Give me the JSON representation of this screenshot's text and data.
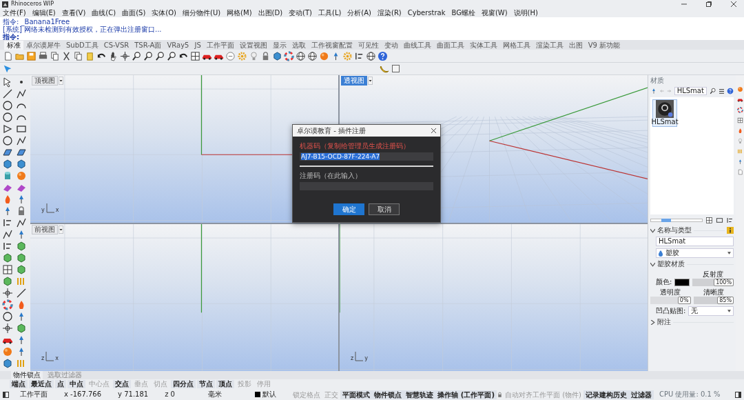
{
  "window": {
    "title": "Rhinoceros WIP"
  },
  "menu": [
    "文件(F)",
    "编辑(E)",
    "查看(V)",
    "曲线(C)",
    "曲面(S)",
    "实体(O)",
    "细分物件(U)",
    "网格(M)",
    "出图(D)",
    "变动(T)",
    "工具(L)",
    "分析(A)",
    "渲染(R)",
    "Cyberstrak",
    "BG螺栓",
    "视窗(W)",
    "说明(H)"
  ],
  "command_history": [
    "指令: _Banana1Free",
    "[系统] 网络未检测到有效授权，正在弹出注册窗口..."
  ],
  "command_prompt": "指令:",
  "toolbar_tabs": [
    {
      "label": "标准",
      "selected": true
    },
    {
      "label": "卓尔谟犀牛",
      "selected": false
    },
    {
      "label": "SubD工具",
      "selected": false
    },
    {
      "label": "CS-VSR",
      "selected": false
    },
    {
      "label": "TSR-A面",
      "selected": false
    },
    {
      "label": "VRay5",
      "selected": false
    },
    {
      "label": "JS",
      "selected": false
    },
    {
      "label": "工作平面",
      "selected": false
    },
    {
      "label": "设置视图",
      "selected": false
    },
    {
      "label": "显示",
      "selected": false
    },
    {
      "label": "选取",
      "selected": false
    },
    {
      "label": "工作视窗配置",
      "selected": false
    },
    {
      "label": "可见性",
      "selected": false
    },
    {
      "label": "变动",
      "selected": false
    },
    {
      "label": "曲线工具",
      "selected": false
    },
    {
      "label": "曲面工具",
      "selected": false
    },
    {
      "label": "实体工具",
      "selected": false
    },
    {
      "label": "网格工具",
      "selected": false
    },
    {
      "label": "渲染工具",
      "selected": false
    },
    {
      "label": "出图",
      "selected": false
    },
    {
      "label": "V9 新功能",
      "selected": false
    }
  ],
  "viewports": [
    {
      "kind": "top",
      "label": "顶视图",
      "selected": false,
      "axis_labels": [
        "y",
        "x"
      ]
    },
    {
      "kind": "perspective",
      "label": "透视图",
      "selected": true
    },
    {
      "kind": "front",
      "label": "前视图",
      "selected": false,
      "axis_labels": [
        "z",
        "x"
      ]
    },
    {
      "kind": "right",
      "axis_labels": [
        "z",
        "y"
      ]
    }
  ],
  "toolbar_checkbox": {
    "checked": false
  },
  "dialog": {
    "title": "卓尔谟教育 - 插件注册",
    "machine_code_label": "机器码（复制给管理员生成注册码）",
    "machine_code": "AJ7-B15-OCD-87F-224-A7",
    "machine_code_selected": true,
    "register_label": "注册码（在此输入）",
    "buttons": [
      {
        "label": "确定",
        "kind": "primary"
      },
      {
        "label": "取消",
        "kind": "secondary"
      }
    ]
  },
  "materials_panel": {
    "title": "材质",
    "search_value": "HLSmat",
    "items": [
      {
        "label": "HLSmat",
        "selected": true
      }
    ],
    "size_slider": {
      "level": 0.3
    },
    "name_type": {
      "title": "名称与类型",
      "expanded": true,
      "name": "HLSmat",
      "type": "塑胶"
    },
    "plastic": {
      "title": "塑胶材质",
      "expanded": true,
      "color_label": "颜色:",
      "reflectivity": {
        "label": "反射度",
        "reading": "100%",
        "level": 1
      },
      "transparency": {
        "label": "透明度",
        "reading": "0%",
        "level": 0
      },
      "clarity": {
        "label": "清晰度",
        "reading": "85%",
        "level": 0.85
      },
      "bump_label": "凹凸贴图:",
      "bump_value": "无"
    },
    "notes": {
      "title": "附注",
      "expanded": false
    }
  },
  "osnap_tabs": [
    {
      "label": "物件锁点",
      "selected": true
    },
    {
      "label": "选取过滤器",
      "selected": false
    }
  ],
  "osnaps": [
    {
      "label": "端点",
      "checked": true
    },
    {
      "label": "最近点",
      "checked": true
    },
    {
      "label": "点",
      "checked": true
    },
    {
      "label": "中点",
      "checked": true
    },
    {
      "label": "中心点",
      "checked": false
    },
    {
      "label": "交点",
      "checked": true
    },
    {
      "label": "垂点",
      "checked": false
    },
    {
      "label": "切点",
      "checked": false
    },
    {
      "label": "四分点",
      "checked": true
    },
    {
      "label": "节点",
      "checked": true
    },
    {
      "label": "顶点",
      "checked": true
    },
    {
      "label": "投影",
      "checked": false
    },
    {
      "label": "停用",
      "checked": false
    }
  ],
  "status": {
    "cplane": "工作平面",
    "x": "x -167.766",
    "y": "y 71.181",
    "z": "z 0",
    "units": "毫米",
    "layer": "默认",
    "toggles": [
      {
        "label": "锁定格点",
        "on": false,
        "kind": "plain"
      },
      {
        "label": "正交",
        "on": false,
        "kind": "plain"
      },
      {
        "label": "平面模式",
        "on": true,
        "kind": "plain"
      },
      {
        "label": "物件锁点",
        "on": true,
        "kind": "plain"
      },
      {
        "label": "智慧轨迹",
        "on": true,
        "kind": "plain"
      },
      {
        "label": "操作轴 (工作平面)",
        "on": true,
        "kind": "plain"
      },
      {
        "label": "自动对齐工作平面 (物件)",
        "on": false,
        "kind": "locked"
      },
      {
        "label": "记录建构历史",
        "on": true,
        "kind": "plain"
      },
      {
        "label": "过滤器",
        "on": true,
        "kind": "plain"
      }
    ],
    "cpu": "CPU 使用量: 0.1 %"
  }
}
